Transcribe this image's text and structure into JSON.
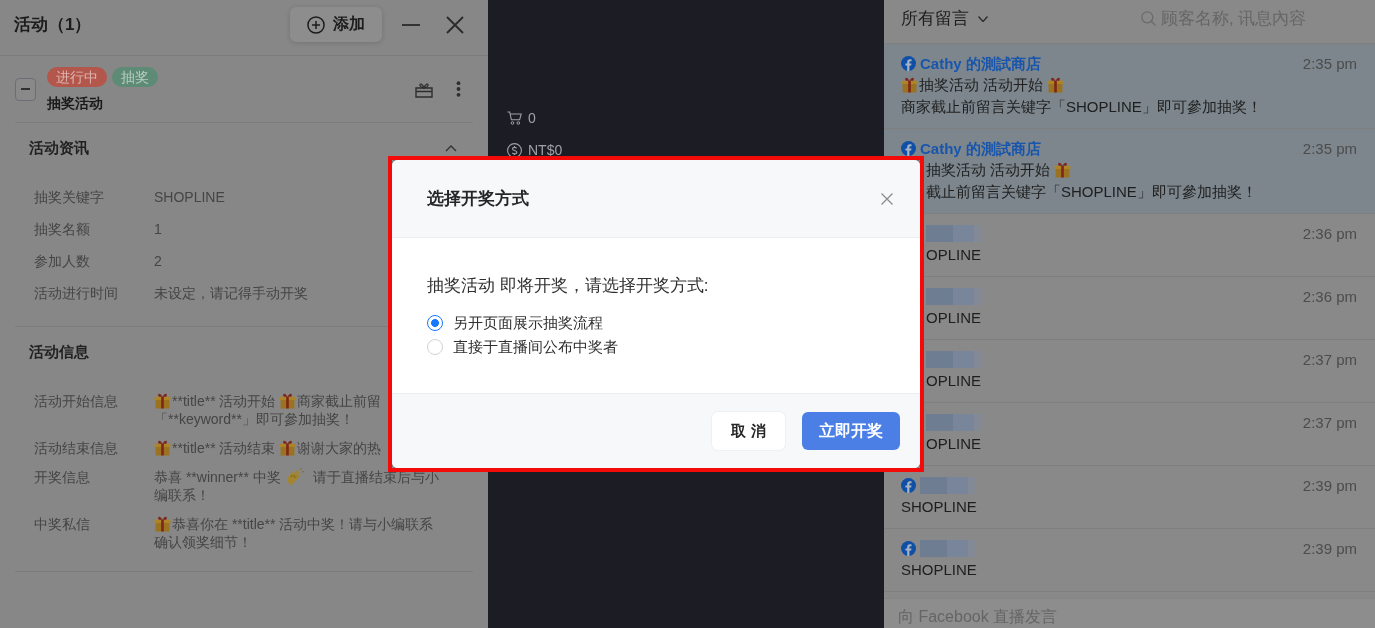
{
  "activity_panel": {
    "title": "活动（1）",
    "add_button": "添加",
    "activity": {
      "expanded": true,
      "tags": [
        {
          "label": "进行中",
          "color": "#b3564b"
        },
        {
          "label": "抽奖",
          "color": "#5e8b75"
        }
      ],
      "name": "抽奖活动"
    },
    "sections": [
      {
        "title": "活动资讯",
        "expanded": true,
        "fields": [
          {
            "label": "抽奖关键字",
            "lines": [
              [
                {
                  "kind": "text",
                  "text": "SHOPLINE"
                }
              ]
            ]
          },
          {
            "label": "抽奖名额",
            "lines": [
              [
                {
                  "kind": "text",
                  "text": "1"
                }
              ]
            ]
          },
          {
            "label": "参加人数",
            "lines": [
              [
                {
                  "kind": "text",
                  "text": "2"
                }
              ]
            ]
          },
          {
            "label": "活动进行时间",
            "lines": [
              [
                {
                  "kind": "text",
                  "text": "未设定，请记得手动开奖"
                }
              ]
            ]
          }
        ]
      },
      {
        "title": "活动信息",
        "fields": [
          {
            "label": "活动开始信息",
            "lines": [
              [
                {
                  "kind": "gift"
                },
                {
                  "kind": "text",
                  "text": "**title** 活动开始"
                },
                {
                  "kind": "gift"
                },
                {
                  "kind": "text",
                  "text": "商家截止前留"
                }
              ],
              [
                {
                  "kind": "text",
                  "text": "「**keyword**」即可參加抽奖！"
                }
              ]
            ]
          },
          {
            "label": "活动结束信息",
            "lines": [
              [
                {
                  "kind": "gift"
                },
                {
                  "kind": "text",
                  "text": "**title** 活动结束"
                },
                {
                  "kind": "gift"
                },
                {
                  "kind": "text",
                  "text": "谢谢大家的热"
                }
              ]
            ]
          },
          {
            "label": "开奖信息",
            "lines": [
              [
                {
                  "kind": "text",
                  "text": "恭喜 **winner** 中奖"
                },
                {
                  "kind": "clap"
                },
                {
                  "kind": "text",
                  "text": "请于直播结束后与小"
                }
              ],
              [
                {
                  "kind": "text",
                  "text": "编联系！"
                }
              ]
            ]
          },
          {
            "label": "中奖私信",
            "lines": [
              [
                {
                  "kind": "gift"
                },
                {
                  "kind": "text",
                  "text": "恭喜你在 **title** 活动中奖！请与小编联系"
                }
              ],
              [
                {
                  "kind": "text",
                  "text": "确认领奖细节！"
                }
              ]
            ]
          }
        ]
      }
    ]
  },
  "stream_panel": {
    "stats": [
      {
        "kind": "cart",
        "text": "0"
      },
      {
        "kind": "money",
        "text": "NT$0"
      }
    ]
  },
  "comments_panel": {
    "filter": "所有留言",
    "search": {
      "placeholder": "顾客名称, 讯息內容"
    },
    "comments": [
      {
        "highlighted": true,
        "platform_icon": true,
        "blurred": false,
        "author": "Cathy 的測試商店",
        "time": "2:35 pm",
        "lines": [
          [
            {
              "kind": "gift"
            },
            {
              "kind": "text",
              "text": "抽奖活动 活动开始"
            },
            {
              "kind": "gift"
            }
          ],
          [
            {
              "kind": "text",
              "text": "商家截止前留言关键字「SHOPLINE」即可參加抽奖！"
            }
          ]
        ]
      },
      {
        "highlighted": true,
        "platform_icon": true,
        "blurred": false,
        "author": "Cathy 的測試商店",
        "time": "2:35 pm",
        "lines": [
          [
            {
              "kind": "text",
              "text": "抽奖活动 活动开始"
            },
            {
              "kind": "gift"
            }
          ],
          [
            {
              "kind": "text",
              "text": "截止前留言关键字「SHOPLINE」即可參加抽奖！"
            }
          ]
        ]
      },
      {
        "highlighted": false,
        "platform_icon": false,
        "blurred": true,
        "time": "2:36 pm",
        "lines": [
          [
            {
              "kind": "text",
              "text": "OPLINE"
            }
          ]
        ]
      },
      {
        "highlighted": false,
        "platform_icon": false,
        "blurred": true,
        "time": "2:36 pm",
        "lines": [
          [
            {
              "kind": "text",
              "text": "OPLINE"
            }
          ]
        ]
      },
      {
        "highlighted": false,
        "platform_icon": false,
        "blurred": true,
        "time": "2:37 pm",
        "lines": [
          [
            {
              "kind": "text",
              "text": "OPLINE"
            }
          ]
        ]
      },
      {
        "highlighted": false,
        "platform_icon": false,
        "blurred": true,
        "time": "2:37 pm",
        "lines": [
          [
            {
              "kind": "text",
              "text": "OPLINE"
            }
          ]
        ]
      },
      {
        "highlighted": false,
        "platform_icon": true,
        "blurred": true,
        "time": "2:39 pm",
        "lines": [
          [
            {
              "kind": "text",
              "text": "SHOPLINE"
            }
          ]
        ]
      },
      {
        "highlighted": false,
        "platform_icon": true,
        "blurred": true,
        "time": "2:39 pm",
        "lines": [
          [
            {
              "kind": "text",
              "text": "SHOPLINE"
            }
          ]
        ]
      }
    ],
    "comment_input": {
      "placeholder": "向 Facebook 直播发言"
    }
  },
  "dialog": {
    "title": "选择开奖方式",
    "prompt": "抽奖活动 即将开奖，请选择开奖方式:",
    "options": [
      {
        "label": "另开页面展示抽奖流程",
        "selected": true
      },
      {
        "label": "直接于直播间公布中奖者",
        "selected": false
      }
    ],
    "buttons": [
      {
        "label": "取 消",
        "kind": "secondary"
      },
      {
        "label": "立即开奖",
        "kind": "primary"
      }
    ]
  }
}
